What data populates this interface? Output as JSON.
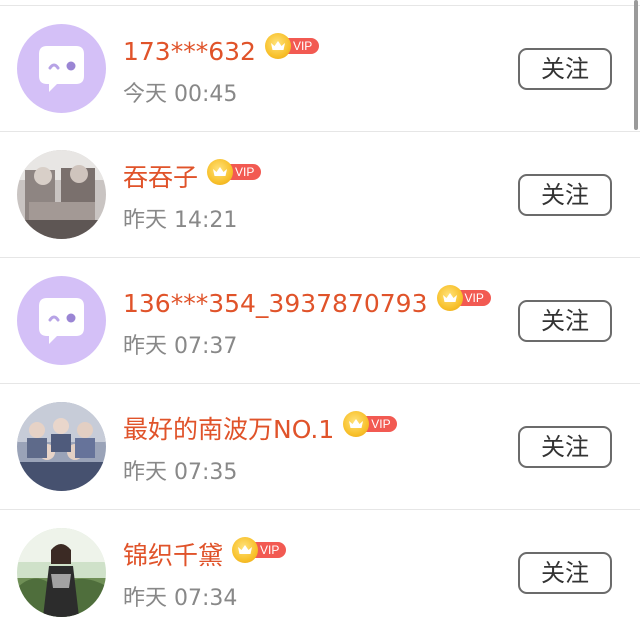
{
  "follow_list": [
    {
      "username": "173***632",
      "badge": "VIP",
      "time": "今天 00:45",
      "button": "关注",
      "avatar": "default-chat-avatar"
    },
    {
      "username": "吞吞子",
      "badge": "VIP",
      "time": "昨天 14:21",
      "button": "关注",
      "avatar": "photo-avatar"
    },
    {
      "username": "136***354_3937870793",
      "badge": "VIP",
      "time": "昨天 07:37",
      "button": "关注",
      "avatar": "default-chat-avatar"
    },
    {
      "username": "最好的南波万NO.1",
      "badge": "VIP",
      "time": "昨天 07:35",
      "button": "关注",
      "avatar": "group-photo-avatar"
    },
    {
      "username": "锦织千黛",
      "badge": "VIP",
      "time": "昨天 07:34",
      "button": "关注",
      "avatar": "photo-avatar"
    }
  ],
  "colors": {
    "username": "#e0532a",
    "vip_pill": "#f25a52",
    "crown": "#f8c12c",
    "time": "#888888",
    "button_border": "#6b6b6b",
    "default_avatar": "#d4c0f7"
  }
}
